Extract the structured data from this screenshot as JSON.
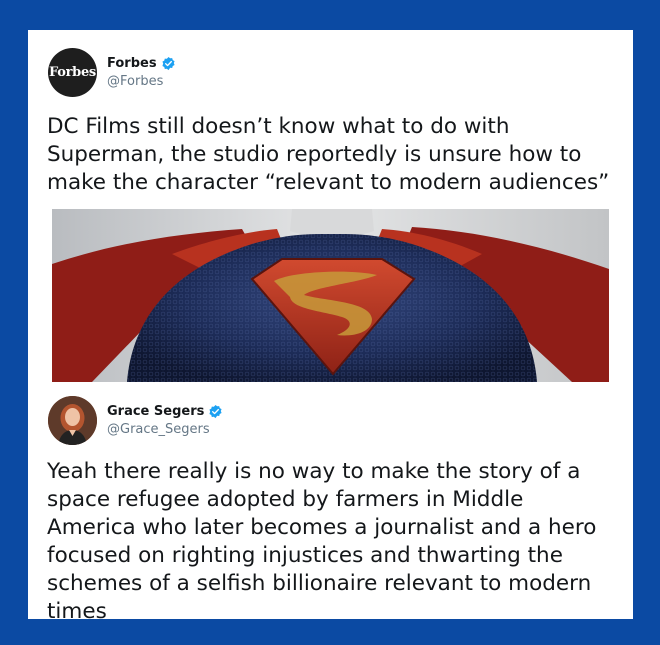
{
  "tweet1": {
    "avatar_text": "Forbes",
    "name": "Forbes",
    "handle": "@Forbes",
    "text": "DC Films still doesn’t know what to do with Superman, the studio reportedly is unsure how to make the character “relevant to modern audiences”",
    "verified": true
  },
  "tweet2": {
    "name": "Grace Segers",
    "handle": "@Grace_Segers",
    "text": "Yeah there really is no way to make the story of a space refugee adopted by farmers in Middle America who later becomes a journalist and a hero focused on righting injustices and thwarting the schemes of a selfish billionaire relevant to modern times",
    "verified": true
  },
  "colors": {
    "background": "#0b4aa3",
    "verified_badge": "#1da1f2",
    "suit_blue": "#1b2a55",
    "cape_red": "#a8251c",
    "emblem_gold": "#c79a3a"
  }
}
